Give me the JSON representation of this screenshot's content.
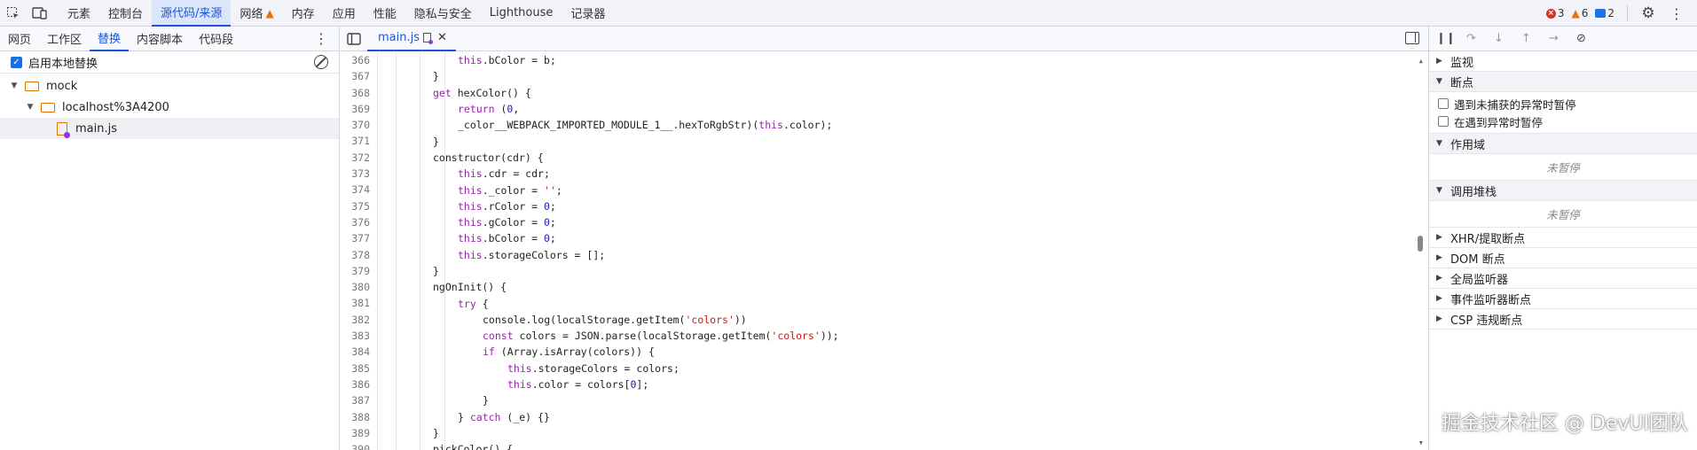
{
  "top_tabs": [
    {
      "label": "元素",
      "active": false
    },
    {
      "label": "控制台",
      "active": false
    },
    {
      "label": "源代码/来源",
      "active": true
    },
    {
      "label": "网络",
      "active": false,
      "warning": true
    },
    {
      "label": "内存",
      "active": false
    },
    {
      "label": "应用",
      "active": false
    },
    {
      "label": "性能",
      "active": false
    },
    {
      "label": "隐私与安全",
      "active": false
    },
    {
      "label": "Lighthouse",
      "active": false
    },
    {
      "label": "记录器",
      "active": false
    }
  ],
  "status": {
    "errors": "3",
    "warnings": "6",
    "messages": "2"
  },
  "left_panel": {
    "tabs": [
      {
        "label": "网页",
        "active": false
      },
      {
        "label": "工作区",
        "active": false
      },
      {
        "label": "替换",
        "active": true
      },
      {
        "label": "内容脚本",
        "active": false
      },
      {
        "label": "代码段",
        "active": false
      }
    ],
    "enable_overrides_label": "启用本地替换",
    "enable_overrides_checked": true,
    "tree": [
      {
        "label": "mock",
        "level": 0,
        "type": "folder"
      },
      {
        "label": "localhost%3A4200",
        "level": 1,
        "type": "folder"
      },
      {
        "label": "main.js",
        "level": 2,
        "type": "file",
        "selected": true
      }
    ]
  },
  "editor": {
    "file_tab": "main.js",
    "lines": [
      {
        "n": "366",
        "indent": 2,
        "code": "this.bColor = b;"
      },
      {
        "n": "367",
        "indent": 1,
        "code": "}"
      },
      {
        "n": "368",
        "indent": 1,
        "code": "get hexColor() {"
      },
      {
        "n": "369",
        "indent": 2,
        "code": "return (0,"
      },
      {
        "n": "370",
        "indent": 2,
        "code": "_color__WEBPACK_IMPORTED_MODULE_1__.hexToRgbStr)(this.color);"
      },
      {
        "n": "371",
        "indent": 1,
        "code": "}"
      },
      {
        "n": "372",
        "indent": 1,
        "code": "constructor(cdr) {"
      },
      {
        "n": "373",
        "indent": 2,
        "code": "this.cdr = cdr;"
      },
      {
        "n": "374",
        "indent": 2,
        "code": "this._color = '';"
      },
      {
        "n": "375",
        "indent": 2,
        "code": "this.rColor = 0;"
      },
      {
        "n": "376",
        "indent": 2,
        "code": "this.gColor = 0;"
      },
      {
        "n": "377",
        "indent": 2,
        "code": "this.bColor = 0;"
      },
      {
        "n": "378",
        "indent": 2,
        "code": "this.storageColors = [];"
      },
      {
        "n": "379",
        "indent": 1,
        "code": "}"
      },
      {
        "n": "380",
        "indent": 1,
        "code": "ngOnInit() {"
      },
      {
        "n": "381",
        "indent": 2,
        "code": "try {"
      },
      {
        "n": "382",
        "indent": 3,
        "code": "console.log(localStorage.getItem('colors'))"
      },
      {
        "n": "383",
        "indent": 3,
        "code": "const colors = JSON.parse(localStorage.getItem('colors'));"
      },
      {
        "n": "384",
        "indent": 3,
        "code": "if (Array.isArray(colors)) {"
      },
      {
        "n": "385",
        "indent": 4,
        "code": "this.storageColors = colors;"
      },
      {
        "n": "386",
        "indent": 4,
        "code": "this.color = colors[0];"
      },
      {
        "n": "387",
        "indent": 3,
        "code": "}"
      },
      {
        "n": "388",
        "indent": 2,
        "code": "} catch (_e) {}"
      },
      {
        "n": "389",
        "indent": 1,
        "code": "}"
      },
      {
        "n": "390",
        "indent": 1,
        "code": "pickColor() {"
      }
    ]
  },
  "debugger": {
    "sections": [
      {
        "label": "监视",
        "open": false
      },
      {
        "label": "断点",
        "open": true,
        "items": [
          "遇到未捕获的异常时暂停",
          "在遇到异常时暂停"
        ]
      },
      {
        "label": "作用域",
        "open": true,
        "empty": "未暂停"
      },
      {
        "label": "调用堆栈",
        "open": true,
        "empty": "未暂停"
      },
      {
        "label": "XHR/提取断点",
        "open": false
      },
      {
        "label": "DOM 断点",
        "open": false
      },
      {
        "label": "全局监听器",
        "open": false
      },
      {
        "label": "事件监听器断点",
        "open": false
      },
      {
        "label": "CSP 违规断点",
        "open": false
      }
    ]
  },
  "watermark": "掘金技术社区 @ DevUI团队",
  "colors": {
    "accent": "#1a56d8",
    "keyword": "#9b1fb0",
    "number": "#1a1aa6",
    "string": "#c41a16",
    "file_orange": "#e37400"
  }
}
